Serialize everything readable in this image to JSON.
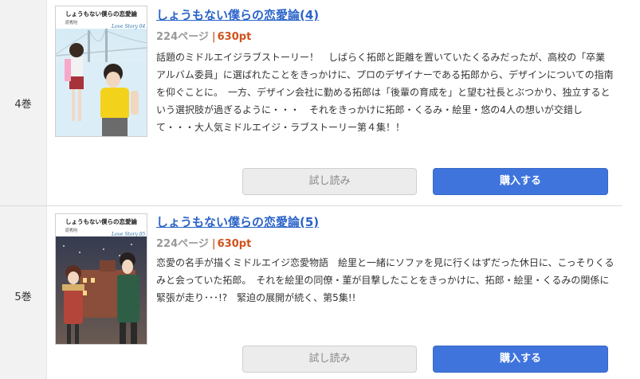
{
  "volumes": [
    {
      "volume_label": "4巻",
      "title": "しょうもない僕らの恋愛論(4)",
      "pages": "224ページ",
      "separator": "|",
      "price": "630pt",
      "description": "話題のミドルエイジラブストーリー！　しばらく拓郎と距離を置いていたくるみだったが、高校の「卒業アルバム委員」に選ばれたことをきっかけに、プロのデザイナーである拓郎から、デザインについての指南を仰ぐことに。　一方、デザイン会社に勤める拓郎は「後輩の育成を」と望む社長とぶつかり、独立するという選択肢が過ぎるように・・・　それをきっかけに拓郎・くるみ・絵里・悠の4人の想いが交錯して・・・大人気ミドルエイジ・ラブストーリー第４集！！",
      "trial_label": "試し読み",
      "buy_label": "購入する",
      "cover": {
        "series_title": "しょうもない僕らの恋愛論",
        "author": "原秀則",
        "logo": "Love Story 04"
      }
    },
    {
      "volume_label": "5巻",
      "title": "しょうもない僕らの恋愛論(5)",
      "pages": "224ページ",
      "separator": "|",
      "price": "630pt",
      "description": "恋愛の名手が描くミドルエイジ恋愛物語　絵里と一緒にソファを見に行くはずだった休日に、こっそりくるみと会っていた拓郎。　それを絵里の同僚・菫が目撃したことをきっかけに、拓郎・絵里・くるみの関係に緊張が走り･･･!?　緊迫の展開が続く、第5集!!",
      "trial_label": "試し読み",
      "buy_label": "購入する",
      "cover": {
        "series_title": "しょうもない僕らの恋愛論",
        "author": "原秀則",
        "logo": "Love Story 05"
      }
    }
  ],
  "colors": {
    "title_link": "#2a63c9",
    "price": "#d0521b",
    "buy_button": "#3f74dc",
    "trial_button": "#ececec"
  }
}
